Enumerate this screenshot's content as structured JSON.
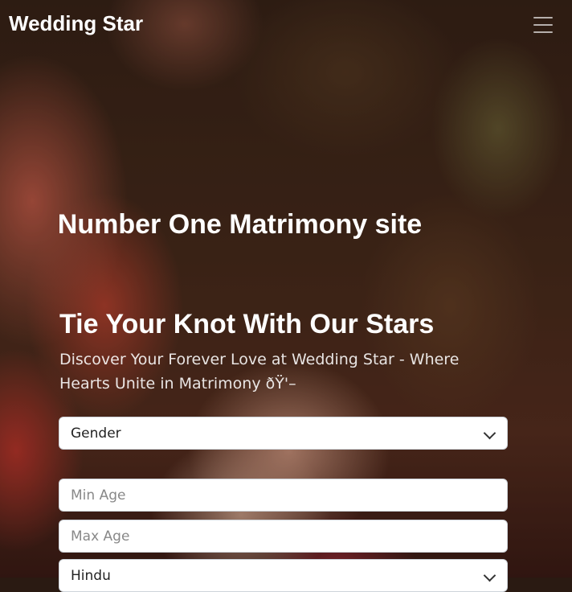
{
  "brand": "Wedding Star",
  "marquee": "India's Number One Matrimony site",
  "hero": {
    "title": "Tie Your Knot With Our Stars",
    "subtitle": "Discover Your Forever Love at Wedding Star - Where Hearts Unite in Matrimony ðŸ'–"
  },
  "form": {
    "gender": "Gender",
    "min_age_placeholder": "Min Age",
    "max_age_placeholder": "Max Age",
    "religion": "Hindu"
  },
  "icons": {
    "menu": "hamburger-menu-icon",
    "dropdown": "chevron-down-icon"
  }
}
